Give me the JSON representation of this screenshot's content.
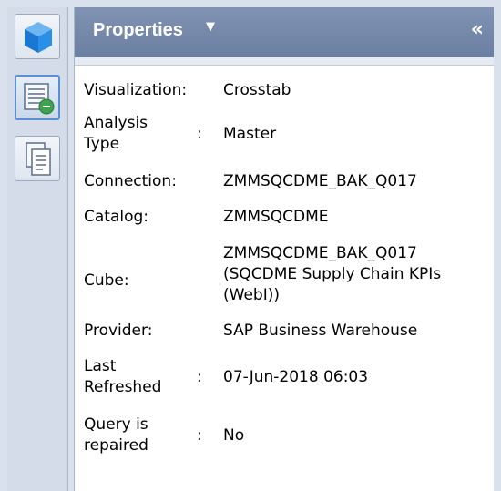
{
  "panel": {
    "title": "Properties",
    "title_caret": "▼",
    "collapse_glyph": "«"
  },
  "strip": {
    "buttons": [
      {
        "icon": "cube-icon"
      },
      {
        "icon": "properties-icon",
        "active": true
      },
      {
        "icon": "documents-icon"
      }
    ]
  },
  "properties": [
    {
      "label": "Visualization:",
      "colon": "",
      "value": [
        "Crosstab"
      ]
    },
    {
      "label": "Analysis Type",
      "colon": ":",
      "value": [
        "Master"
      ]
    },
    {
      "label": "Connection:",
      "colon": "",
      "value": [
        "ZMMSQCDME_BAK_Q017"
      ]
    },
    {
      "label": "Catalog:",
      "colon": "",
      "value": [
        "ZMMSQCDME"
      ]
    },
    {
      "label": "Cube:",
      "colon": "",
      "value": [
        "ZMMSQCDME_BAK_Q017",
        "(SQCDME Supply Chain KPIs",
        "(WebI))"
      ]
    },
    {
      "label": "Provider:",
      "colon": "",
      "value": [
        "SAP Business Warehouse"
      ]
    },
    {
      "label": "Last Refreshed",
      "colon": ":",
      "value": [
        "07-Jun-2018 06:03"
      ]
    },
    {
      "label": "Query is repaired",
      "colon": ":",
      "value": [
        "No"
      ]
    }
  ],
  "labels_split": {
    "analysis_type": [
      "Analysis",
      "Type"
    ],
    "last_refreshed": [
      "Last",
      "Refreshed"
    ],
    "query_repaired": [
      "Query is",
      "repaired"
    ]
  }
}
